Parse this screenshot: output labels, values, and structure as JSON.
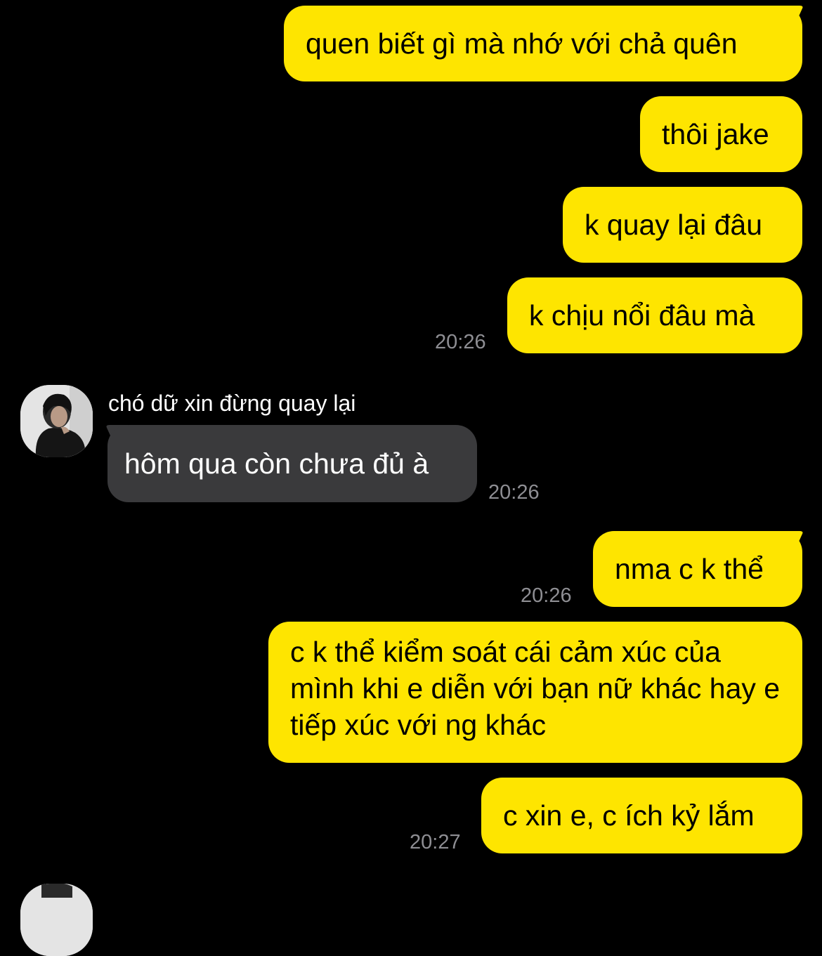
{
  "messages": {
    "m1": {
      "text": "quen biết gì mà nhớ với chả quên"
    },
    "m2": {
      "text": "thôi jake"
    },
    "m3": {
      "text": "k quay lại đâu"
    },
    "m4": {
      "text": "k chịu nổi đâu mà",
      "time": "20:26"
    },
    "m5": {
      "sender": "chó dữ xin đừng quay lại",
      "text": "hôm qua còn chưa đủ à",
      "time": "20:26"
    },
    "m6": {
      "text": "nma c k thể",
      "time": "20:26"
    },
    "m7": {
      "text": "c k thể kiểm soát cái cảm xúc của mình khi e diễn với bạn nữ khác hay e tiếp xúc với ng khác"
    },
    "m8": {
      "text": "c xin e, c ích kỷ lắm",
      "time": "20:27"
    }
  },
  "colors": {
    "background": "#000000",
    "outgoing_bubble": "#FEE500",
    "incoming_bubble": "#3A3A3C",
    "timestamp": "#8E8E93"
  },
  "icons": {
    "avatar": "profile-photo"
  }
}
